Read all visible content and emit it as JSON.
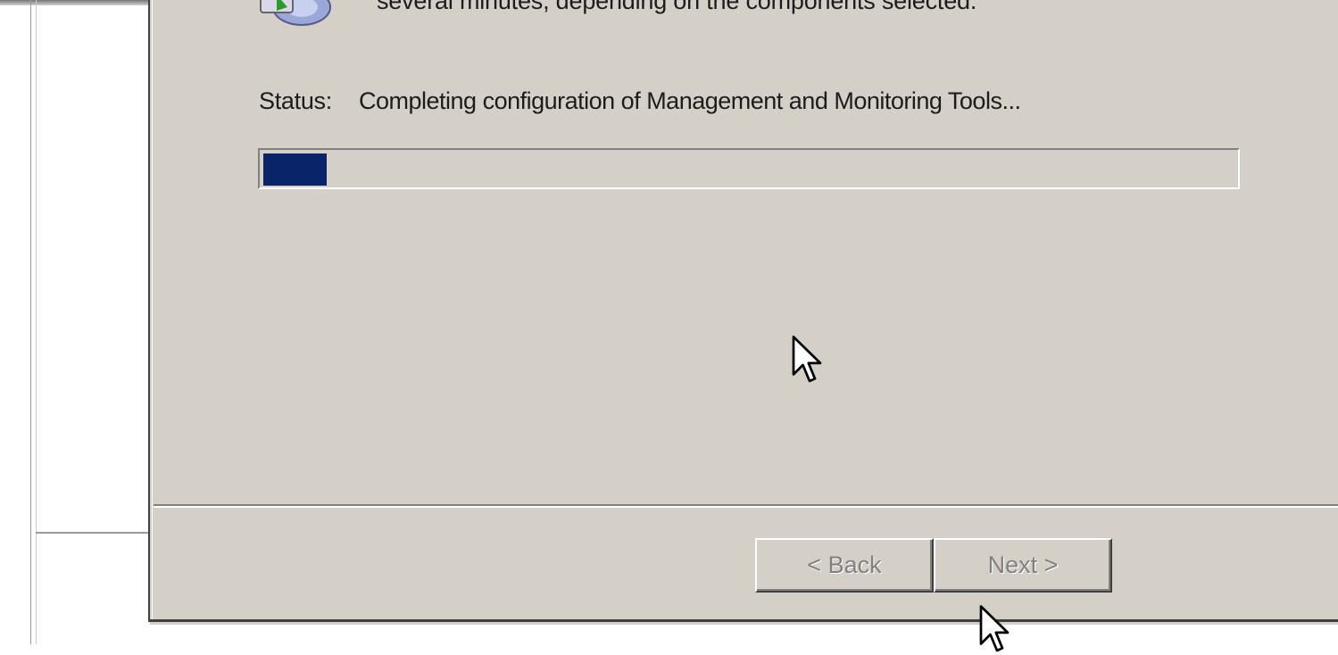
{
  "wizard": {
    "intro_text": "several minutes, depending on the components selected.",
    "status_label": "Status:",
    "status_text": "Completing configuration of Management and Monitoring Tools...",
    "progress_value": 0.065
  },
  "buttons": {
    "back_label": "< Back",
    "next_label": "Next >"
  },
  "icons": {
    "setup": "setup-disk-icon",
    "cursor": "mouse-pointer-icon"
  },
  "colors": {
    "dialog_face": "#d4d0c8",
    "progress_fill": "#0a246a",
    "disabled_text": "#808080"
  }
}
